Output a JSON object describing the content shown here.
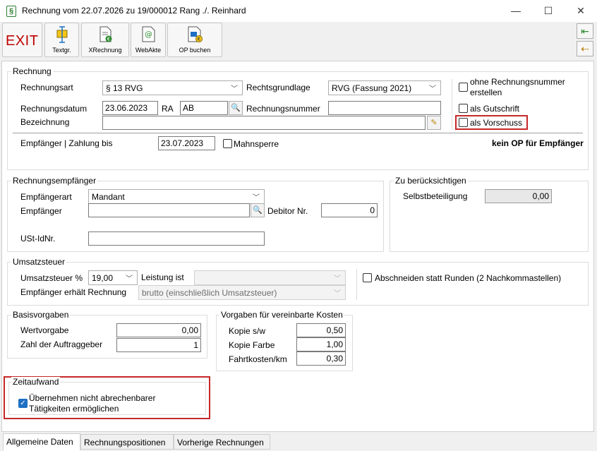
{
  "window": {
    "title": "Rechnung vom 22.07.2026 zu 19/000012 Rang ./. Reinhard",
    "minimize": "—",
    "maximize": "☐",
    "close": "✕"
  },
  "toolbar": {
    "exit": "EXIT",
    "textgr": "Textgr.",
    "xrechnung": "XRechnung",
    "webakte": "WebAkte",
    "op_buchen": "OP buchen"
  },
  "rechnung": {
    "group": "Rechnung",
    "art_label": "Rechnungsart",
    "art_value": "§ 13 RVG",
    "grundlage_label": "Rechtsgrundlage",
    "grundlage_value": "RVG (Fassung 2021)",
    "datum_label": "Rechnungsdatum",
    "datum_value": "23.06.2023",
    "ra_label": "RA",
    "ra_value": "AB",
    "nummer_label": "Rechnungsnummer",
    "nummer_value": "",
    "bezeichnung_label": "Bezeichnung",
    "bezeichnung_value": "",
    "ohne_nummer_1": "ohne Rechnungsnummer",
    "ohne_nummer_2": "erstellen",
    "gutschrift": "als Gutschrift",
    "vorschuss": "als Vorschuss",
    "empf_zahlung_label": "Empfänger | Zahlung bis",
    "zahlung_bis": "23.07.2023",
    "mahnsperre": "Mahnsperre",
    "kein_op": "kein OP für Empfänger"
  },
  "empfaenger": {
    "group": "Rechnungsempfänger",
    "art_label": "Empfängerart",
    "art_value": "Mandant",
    "empf_label": "Empfänger",
    "empf_value": "",
    "debitor_label": "Debitor Nr.",
    "debitor_value": "0",
    "ust_label": "USt-IdNr.",
    "ust_value": ""
  },
  "beruecksichtigen": {
    "group": "Zu berücksichtigen",
    "selbst_label": "Selbstbeteiligung",
    "selbst_value": "0,00"
  },
  "umsatzsteuer": {
    "group": "Umsatzsteuer",
    "prozent_label": "Umsatzsteuer %",
    "prozent_value": "19,00",
    "leistung_label": "Leistung ist",
    "leistung_value": "",
    "erhaelt_label": "Empfänger erhält Rechnung",
    "erhaelt_value": "brutto (einschließlich Umsatzsteuer)",
    "abschneiden": "Abschneiden statt Runden (2 Nachkommastellen)"
  },
  "basis": {
    "group": "Basisvorgaben",
    "wert_label": "Wertvorgabe",
    "wert_value": "0,00",
    "zahl_label": "Zahl der Auftraggeber",
    "zahl_value": "1"
  },
  "kosten": {
    "group": "Vorgaben für vereinbarte Kosten",
    "sw_label": "Kopie s/w",
    "sw_value": "0,50",
    "farbe_label": "Kopie Farbe",
    "farbe_value": "1,00",
    "fahrt_label": "Fahrtkosten/km",
    "fahrt_value": "0,30"
  },
  "zeit": {
    "group": "Zeitaufwand",
    "check_1": "Übernehmen nicht abrechenbarer",
    "check_2": "Tätigkeiten ermöglichen"
  },
  "tabs": [
    "Allgemeine Daten",
    "Rechnungspositionen",
    "Vorherige Rechnungen"
  ]
}
